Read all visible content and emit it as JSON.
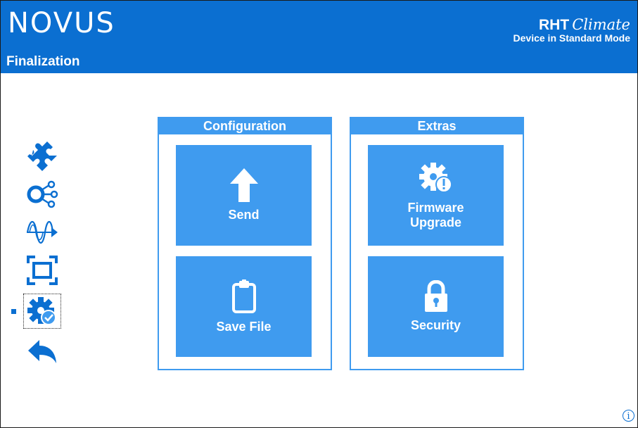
{
  "header": {
    "logo_text": "NOVUS",
    "page_title": "Finalization",
    "product_name": "RHT",
    "product_script": "Climate",
    "device_mode": "Device in Standard Mode"
  },
  "sidebar": {
    "items": [
      {
        "icon": "puzzle-icon",
        "selected": false
      },
      {
        "icon": "network-icon",
        "selected": false
      },
      {
        "icon": "signal-wave-icon",
        "selected": false
      },
      {
        "icon": "display-frame-icon",
        "selected": false
      },
      {
        "icon": "gear-check-icon",
        "selected": true
      },
      {
        "icon": "back-arrow-icon",
        "selected": false
      }
    ]
  },
  "panels": {
    "configuration": {
      "title": "Configuration",
      "send_label": "Send",
      "save_file_label": "Save File"
    },
    "extras": {
      "title": "Extras",
      "firmware_label_line1": "Firmware",
      "firmware_label_line2": "Upgrade",
      "security_label": "Security"
    }
  },
  "info": {
    "label": "i"
  },
  "colors": {
    "header_blue": "#0b6fd1",
    "tile_blue": "#3f9bef",
    "white": "#ffffff"
  }
}
